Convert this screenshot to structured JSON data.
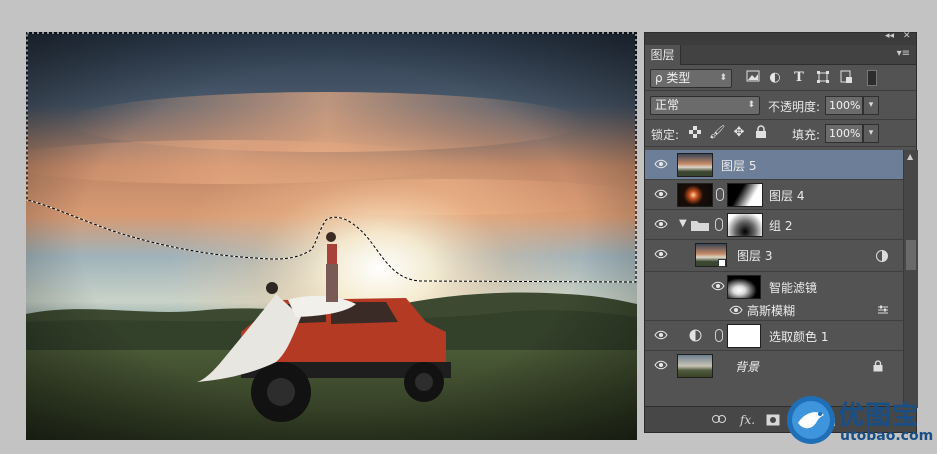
{
  "panel": {
    "tab_label": "图层",
    "collapse_glyph": "◂◂",
    "close_glyph": "✕",
    "menu_glyph": "▾≡",
    "filter_kind": "ρ 类型",
    "blend_mode": "正常",
    "opacity_label": "不透明度:",
    "opacity_value": "100%",
    "lock_label": "锁定:",
    "fill_label": "填充:",
    "fill_value": "100%",
    "filter_icons": [
      "image-filter-icon",
      "adjustment-filter-icon",
      "type-filter-icon",
      "shape-filter-icon",
      "smart-object-filter-icon",
      "filter-toggle-icon"
    ],
    "lock_icons": [
      "lock-transparent-pixels-icon",
      "lock-image-pixels-icon",
      "lock-position-icon",
      "lock-all-icon"
    ]
  },
  "layers": [
    {
      "name": "图层 5",
      "selected": true,
      "thumb": "photo"
    },
    {
      "name": "图层 4",
      "selected": false,
      "thumb": "sun-with-mask"
    },
    {
      "name": "组 2",
      "selected": false,
      "thumb": "group-mask"
    },
    {
      "name": "图层 3",
      "selected": false,
      "thumb": "smart-object"
    },
    {
      "name": "智能滤镜",
      "selected": false,
      "thumb": "filter-mask"
    },
    {
      "name": "高斯模糊",
      "selected": false,
      "thumb": "none"
    },
    {
      "name": "选取颜色 1",
      "selected": false,
      "thumb": "adjustment-mask"
    },
    {
      "name": "背景",
      "selected": false,
      "thumb": "background",
      "locked": true
    }
  ],
  "footer_icons": [
    "link-layers-icon",
    "fx-icon",
    "add-mask-icon",
    "new-adjustment-icon",
    "new-group-icon"
  ],
  "footer_fx": "fx.",
  "watermark": {
    "title": "优图宝",
    "url": "utobao.com"
  }
}
